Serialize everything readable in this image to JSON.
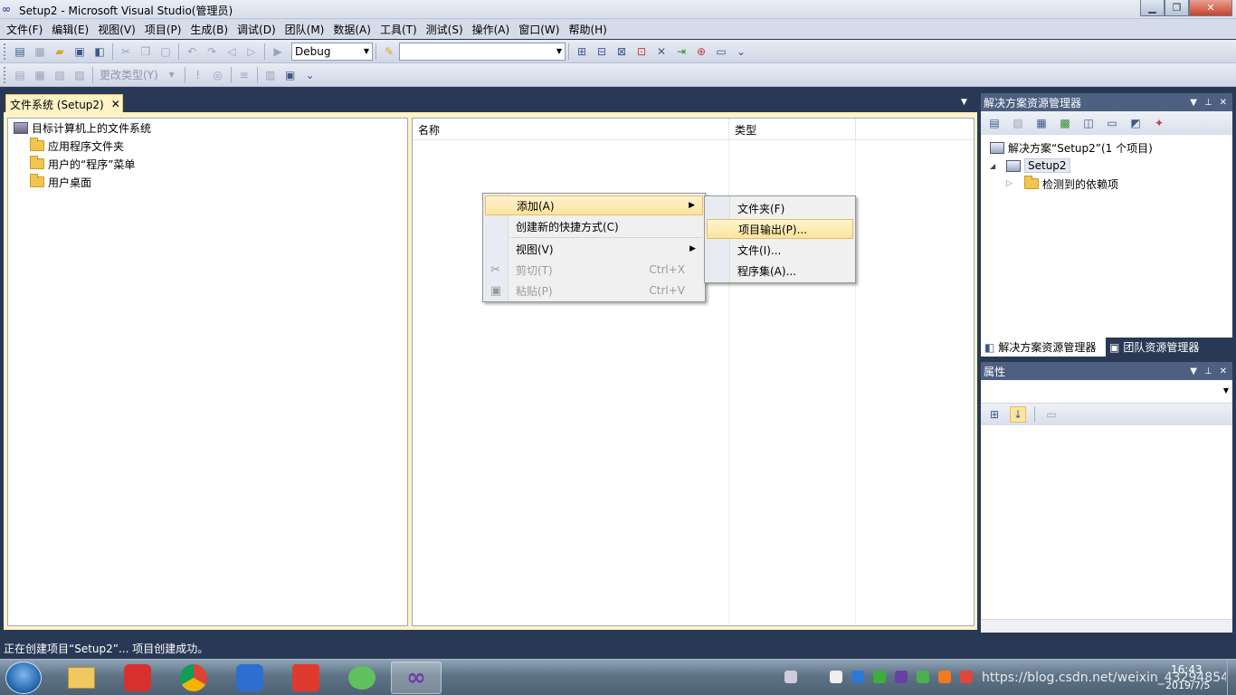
{
  "window": {
    "title": "Setup2 - Microsoft Visual Studio(管理员)"
  },
  "menubar": [
    "文件(F)",
    "编辑(E)",
    "视图(V)",
    "项目(P)",
    "生成(B)",
    "调试(D)",
    "团队(M)",
    "数据(A)",
    "工具(T)",
    "测试(S)",
    "操作(A)",
    "窗口(W)",
    "帮助(H)"
  ],
  "toolbar1": {
    "config_value": "Debug",
    "platform_value": ""
  },
  "toolbar2": {
    "change_type_label": "更改类型(Y)"
  },
  "document": {
    "tab_label": "文件系统 (Setup2)",
    "tree_root": "目标计算机上的文件系统",
    "tree_items": [
      "应用程序文件夹",
      "用户的“程序”菜单",
      "用户桌面"
    ],
    "columns": [
      "名称",
      "类型"
    ]
  },
  "context_menu": {
    "items": [
      {
        "label": "添加(A)",
        "shortcut": "",
        "submenu": true,
        "disabled": false,
        "highlighted": true
      },
      {
        "label": "创建新的快捷方式(C)",
        "shortcut": "",
        "submenu": false,
        "disabled": false,
        "highlighted": false
      },
      {
        "label": "视图(V)",
        "shortcut": "",
        "submenu": true,
        "disabled": false,
        "highlighted": false
      },
      {
        "label": "剪切(T)",
        "shortcut": "Ctrl+X",
        "submenu": false,
        "disabled": true,
        "highlighted": false
      },
      {
        "label": "粘贴(P)",
        "shortcut": "Ctrl+V",
        "submenu": false,
        "disabled": true,
        "highlighted": false
      }
    ],
    "submenu_items": [
      "文件夹(F)",
      "项目输出(P)...",
      "文件(I)...",
      "程序集(A)..."
    ]
  },
  "solution_explorer": {
    "title": "解决方案资源管理器",
    "solution_label": "解决方案“Setup2”(1 个项目)",
    "project_label": "Setup2",
    "dependency_label": "检测到的依赖项",
    "tab_solution": "解决方案资源管理器",
    "tab_team": "团队资源管理器"
  },
  "properties": {
    "title": "属性"
  },
  "statusbar": {
    "text": "正在创建项目“Setup2”... 项目创建成功。"
  },
  "taskbar": {
    "time": "16:43",
    "date": "2019/7/5",
    "watermark": "https://blog.csdn.net/weixin_43294854"
  },
  "colors": {
    "accent": "#293955",
    "tab_active": "#fff3c6",
    "highlight": "#fde49d"
  }
}
